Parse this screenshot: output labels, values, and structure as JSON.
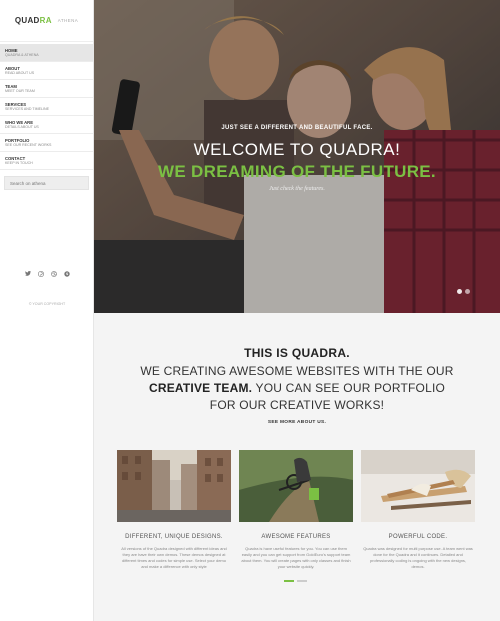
{
  "brand": {
    "name_main": "QUADRA",
    "name_accent": "RA",
    "name_lead": "QUAD",
    "subtitle": "ATHENA"
  },
  "nav": [
    {
      "title": "HOME",
      "sub": "QUADRA & ATHENA",
      "active": true
    },
    {
      "title": "ABOUT",
      "sub": "READ ABOUT US",
      "active": false
    },
    {
      "title": "TEAM",
      "sub": "MEET OUR TEAM",
      "active": false
    },
    {
      "title": "SERVICES",
      "sub": "SERVICES AND TIMELINE",
      "active": false
    },
    {
      "title": "WHO WE ARE",
      "sub": "DETAILS ABOUT US",
      "active": false
    },
    {
      "title": "PORTFOLIO",
      "sub": "SEE OUR RECENT WORKS",
      "active": false
    },
    {
      "title": "CONTACT",
      "sub": "KEEP IN TOUCH",
      "active": false
    }
  ],
  "search": {
    "placeholder": "Search on athena"
  },
  "socials": [
    "twitter-icon",
    "pinterest-icon",
    "dribbble-icon",
    "skype-icon"
  ],
  "copyright": "© YOUR COPYRIGHT",
  "hero": {
    "pre": "JUST SEE A DIFFERENT AND BEAUTIFUL FACE.",
    "title": "WELCOME TO QUADRA!",
    "green": "WE DREAMING OF THE FUTURE.",
    "italic": "Just check the features."
  },
  "intro": {
    "heading": "THIS IS QUADRA.",
    "line1": "WE CREATING AWESOME WEBSITES WITH THE OUR",
    "line2_bold": "CREATIVE TEAM.",
    "line2_rest": " YOU CAN SEE OUR PORTFOLIO",
    "line3": "FOR OUR CREATIVE WORKS!",
    "see_more": "SEE MORE ABOUT US."
  },
  "cards": [
    {
      "title": "DIFFERENT, UNIQUE DESIGNS.",
      "desc": "All versions of the Quadra designed with different ideas and they are have their own demos. These demos designed at different times and codes for simple use. Select your demo and make a difference with only style"
    },
    {
      "title": "AWESOME FEATURES",
      "desc": "Quadra is have useful features for you. You can use them easily and you can get support from GoldEuro's support team about them. You will create pages with only classes and finish your website quickly."
    },
    {
      "title": "POWERFUL CODE.",
      "desc": "Quadra was designed for multi purpose use. A team went was done for the Quadra and it continues. Detailed and professionally coding is ongoing with the new designs, demos."
    }
  ],
  "colors": {
    "accent": "#7bc043"
  }
}
